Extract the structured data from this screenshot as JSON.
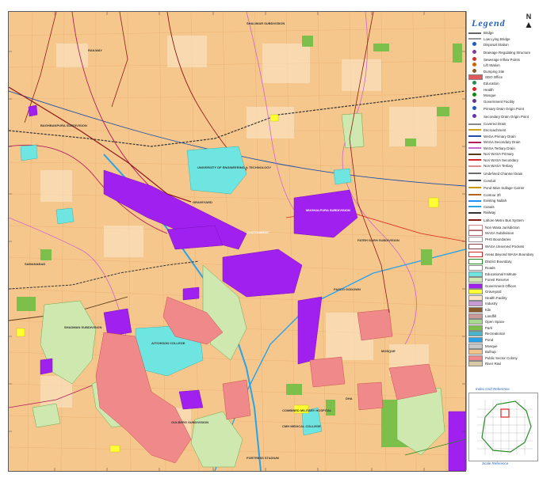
{
  "legend": {
    "title": "Legend",
    "north_label": "N",
    "items": [
      {
        "label": "Bridge",
        "kind": "line",
        "color": "#666666"
      },
      {
        "label": "Low Lying Bridge",
        "kind": "line",
        "color": "#999999"
      },
      {
        "label": "Disposal Station",
        "kind": "dot",
        "color": "#2255cc"
      },
      {
        "label": "Drainage Regulating Structure",
        "kind": "dot",
        "color": "#7a3fa0",
        "tall": true
      },
      {
        "label": "Sewerage Inflow Points",
        "kind": "dot",
        "color": "#cc3333"
      },
      {
        "label": "Lift Station",
        "kind": "dot",
        "color": "#cc6600"
      },
      {
        "label": "Dumping Site",
        "kind": "dot",
        "color": "#8a5a2a"
      },
      {
        "label": "SDO Office",
        "kind": "box",
        "color": "#e05a5a"
      },
      {
        "label": "Education",
        "kind": "dot",
        "color": "#2e8b57"
      },
      {
        "label": "Health",
        "kind": "dot",
        "color": "#d22"
      },
      {
        "label": "Mosque",
        "kind": "dot",
        "color": "#118811"
      },
      {
        "label": "Government Facility",
        "kind": "dot",
        "color": "#5b3a8a"
      },
      {
        "label": "Primary Drain Origin Point",
        "kind": "dot",
        "color": "#2255cc",
        "tall": true
      },
      {
        "label": "Secondary Drain Origin Point",
        "kind": "dot",
        "color": "#6633aa",
        "tall": true
      },
      {
        "label": "Covered Drain",
        "kind": "line",
        "color": "#888888"
      },
      {
        "label": "Encroachment",
        "kind": "line",
        "color": "#d4a017"
      },
      {
        "label": "WASA Primary Drain",
        "kind": "line",
        "color": "#1f4fa8"
      },
      {
        "label": "WASA Secondary Drain",
        "kind": "line",
        "color": "#b01f5c"
      },
      {
        "label": "WASA Tertiary Drain",
        "kind": "line",
        "color": "#cc66cc"
      },
      {
        "label": "Non WASA Primary",
        "kind": "line",
        "color": "#5b3a1a"
      },
      {
        "label": "Non WASA Secondary",
        "kind": "line",
        "color": "#d22"
      },
      {
        "label": "Non WASA Tertiary",
        "kind": "line",
        "color": "#e08a8a"
      },
      {
        "label": "Undefined Channel Drain",
        "kind": "line",
        "color": "#6b6b6b",
        "tall": true
      },
      {
        "label": "Conduit",
        "kind": "line",
        "color": "#444444"
      },
      {
        "label": "Pond Main Sullage Carrier",
        "kind": "line",
        "color": "#cc9900",
        "tall": true
      },
      {
        "label": "Contour 2ft",
        "kind": "line",
        "color": "#b5651d"
      },
      {
        "label": "Existing Nullah",
        "kind": "line",
        "color": "#1e90ff"
      },
      {
        "label": "Canals",
        "kind": "line",
        "color": "#29a3e8"
      },
      {
        "label": "Railway",
        "kind": "line",
        "color": "#333333"
      },
      {
        "label": "Lahore Metro Bus System",
        "kind": "line",
        "color": "#8b1a1a",
        "tall": true
      },
      {
        "label": "Non Wasa Jurisdiction",
        "kind": "box-outline",
        "color": "#cc8888"
      },
      {
        "label": "WASA Subdivision",
        "kind": "box-outline",
        "color": "#aa6666"
      },
      {
        "label": "PHS Boundaries",
        "kind": "box-outline",
        "color": "#999999"
      },
      {
        "label": "WASA Unserved Pockets",
        "kind": "box-outline",
        "color": "#884444",
        "tall": true
      },
      {
        "label": "Areas Beyond WASA Boundary",
        "kind": "box-outline",
        "color": "#cc2222",
        "tall": true
      },
      {
        "label": "District Boundary",
        "kind": "box-outline",
        "color": "#228b22"
      },
      {
        "label": "Roads",
        "kind": "box",
        "color": "#ffffff"
      },
      {
        "label": "Educational Institute",
        "kind": "box",
        "color": "#6ee5e0"
      },
      {
        "label": "Forest Reserve",
        "kind": "box",
        "color": "#cfe8b0"
      },
      {
        "label": "Government Offices",
        "kind": "box",
        "color": "#a020f0"
      },
      {
        "label": "Graveyard",
        "kind": "box",
        "color": "#ffff33"
      },
      {
        "label": "Health Facility",
        "kind": "box",
        "color": "#ffe4c4"
      },
      {
        "label": "Industry",
        "kind": "box",
        "color": "#c89bd6"
      },
      {
        "label": "Kiln",
        "kind": "box",
        "color": "#8a5a2a"
      },
      {
        "label": "Landfill",
        "kind": "box",
        "color": "#cc9999"
      },
      {
        "label": "Open Space",
        "kind": "box",
        "color": "#a7d98f"
      },
      {
        "label": "Park",
        "kind": "box",
        "color": "#7cbf4a"
      },
      {
        "label": "Recreational",
        "kind": "box",
        "color": "#4bb3c8"
      },
      {
        "label": "Pond",
        "kind": "box",
        "color": "#29a3e8"
      },
      {
        "label": "Mosque",
        "kind": "box",
        "color": "#c8c8c8"
      },
      {
        "label": "Bulhup",
        "kind": "box",
        "color": "#f4c38a"
      },
      {
        "label": "Public Sector Colony",
        "kind": "box",
        "color": "#f08a8a"
      },
      {
        "label": "River Ravi",
        "kind": "box",
        "color": "#d8c8a8"
      }
    ]
  },
  "index_grid": {
    "title": "Index Grid Reference"
  },
  "scale_reference": {
    "title": "Scale Reference"
  },
  "map": {
    "labels": [
      "UNIVERSITY OF ENGINEERING & TECHNOLOGY",
      "GRAVEYARD",
      "MUGHALPURA SUBDIVISION",
      "BAGHBANPURA SUBDIVISION",
      "SHALIMAR SUBDIVISION",
      "GULBERG SUBDIVISION",
      "AITCHISON COLLEGE",
      "COMBINED MILITARY HOSPITAL",
      "CMH MEDICAL COLLEGE",
      "FORTRESS STADIUM",
      "DHA",
      "MOSQUE",
      "SAMANABAD",
      "RAILWAY",
      "FATEH GARH SUBDIVISION",
      "SHADMAN SUBDIVISION",
      "CANTONMENT",
      "PASCO GODOWN"
    ]
  }
}
